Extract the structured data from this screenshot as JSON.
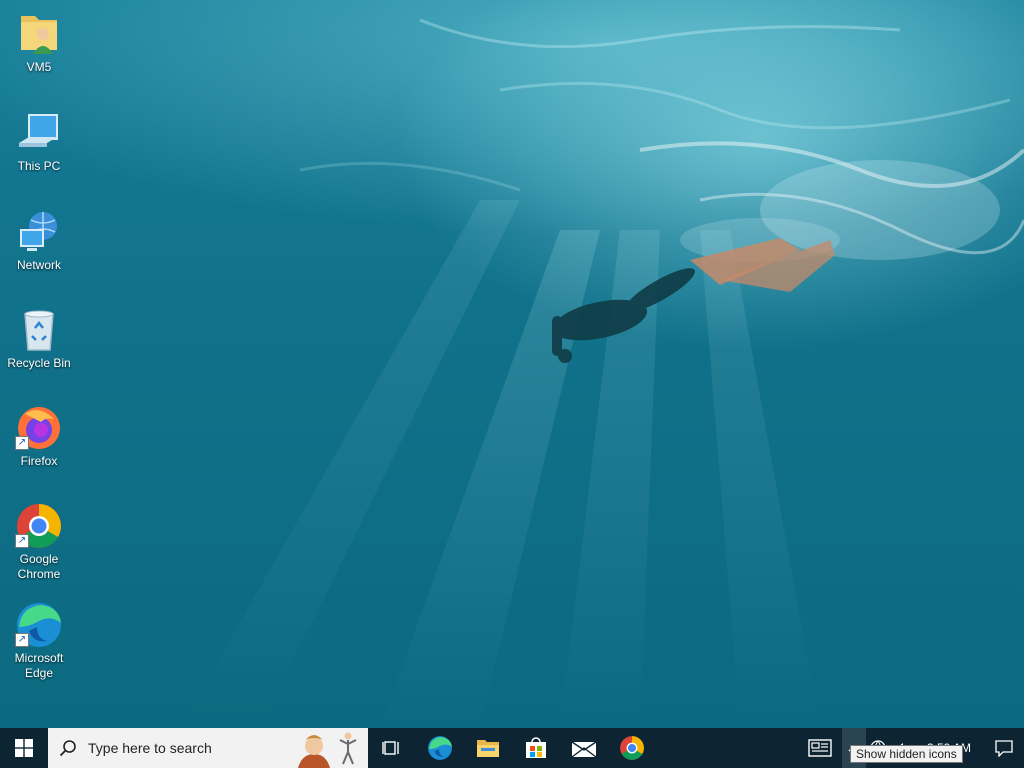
{
  "desktop": {
    "icons": [
      {
        "label": "VM5",
        "icon": "user-folder-icon",
        "shortcut": false
      },
      {
        "label": "This PC",
        "icon": "computer-icon",
        "shortcut": false
      },
      {
        "label": "Network",
        "icon": "network-icon",
        "shortcut": false
      },
      {
        "label": "Recycle Bin",
        "icon": "recycle-bin-icon",
        "shortcut": false
      },
      {
        "label": "Firefox",
        "icon": "firefox-icon",
        "shortcut": true
      },
      {
        "label": "Google Chrome",
        "icon": "chrome-icon",
        "shortcut": true
      },
      {
        "label": "Microsoft Edge",
        "icon": "edge-icon",
        "shortcut": true
      }
    ]
  },
  "taskbar": {
    "search_placeholder": "Type here to search",
    "pinned": [
      "task-view-icon",
      "edge-icon",
      "file-explorer-icon",
      "store-icon",
      "mail-icon",
      "chrome-icon"
    ],
    "clock_time": "3:59 AM",
    "tooltip": "Show hidden icons"
  },
  "colors": {
    "taskbar": "#0d2532",
    "search_bg": "#f2f2f2",
    "water": "#10718a"
  }
}
